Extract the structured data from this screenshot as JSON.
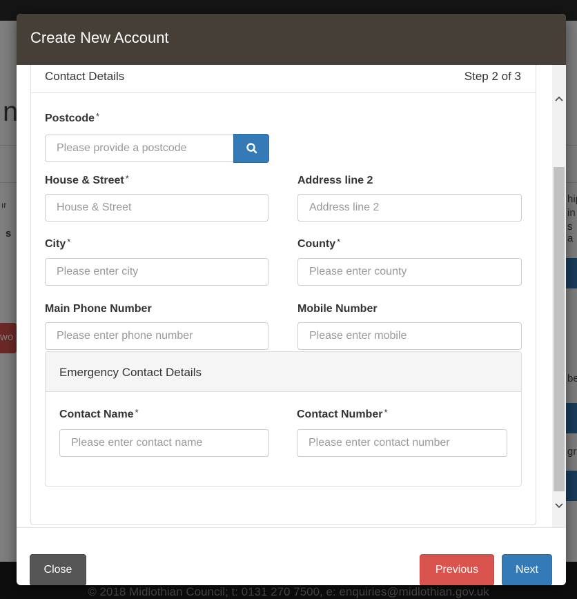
{
  "background": {
    "footer_text": "© 2018 Midlothian Council; t: 0131 270 7500, e: enquiries@midlothian.gov.uk",
    "partial_left": {
      "heading_glyph": "n",
      "text1": "ır",
      "text2": "s",
      "red_button": "wo"
    },
    "partial_right": {
      "text1": "hip",
      "text2": "in",
      "text3": "s a",
      "text4": "be",
      "text5": "gr"
    }
  },
  "modal": {
    "title": "Create New Account",
    "panel": {
      "title": "Contact Details",
      "step": "Step 2 of 3"
    },
    "fields": {
      "postcode": {
        "label": "Postcode",
        "placeholder": "Please provide a postcode"
      },
      "house_street": {
        "label": "House & Street",
        "placeholder": "House & Street"
      },
      "address_line2": {
        "label": "Address line 2",
        "placeholder": "Address line 2"
      },
      "city": {
        "label": "City",
        "placeholder": "Please enter city"
      },
      "county": {
        "label": "County",
        "placeholder": "Please enter county"
      },
      "main_phone": {
        "label": "Main Phone Number",
        "placeholder": "Please enter phone number"
      },
      "mobile": {
        "label": "Mobile Number",
        "placeholder": "Please enter mobile"
      }
    },
    "required_marker": "*",
    "emergency": {
      "title": "Emergency Contact Details",
      "contact_name": {
        "label": "Contact Name",
        "placeholder": "Please enter contact name"
      },
      "contact_number": {
        "label": "Contact Number",
        "placeholder": "Please enter contact number"
      }
    },
    "footer": {
      "close_label": "Close",
      "previous_label": "Previous",
      "next_label": "Next"
    },
    "colors": {
      "header_bg": "#463f37",
      "primary": "#337ab7",
      "danger": "#d9534f",
      "default_dark": "#555555"
    }
  }
}
